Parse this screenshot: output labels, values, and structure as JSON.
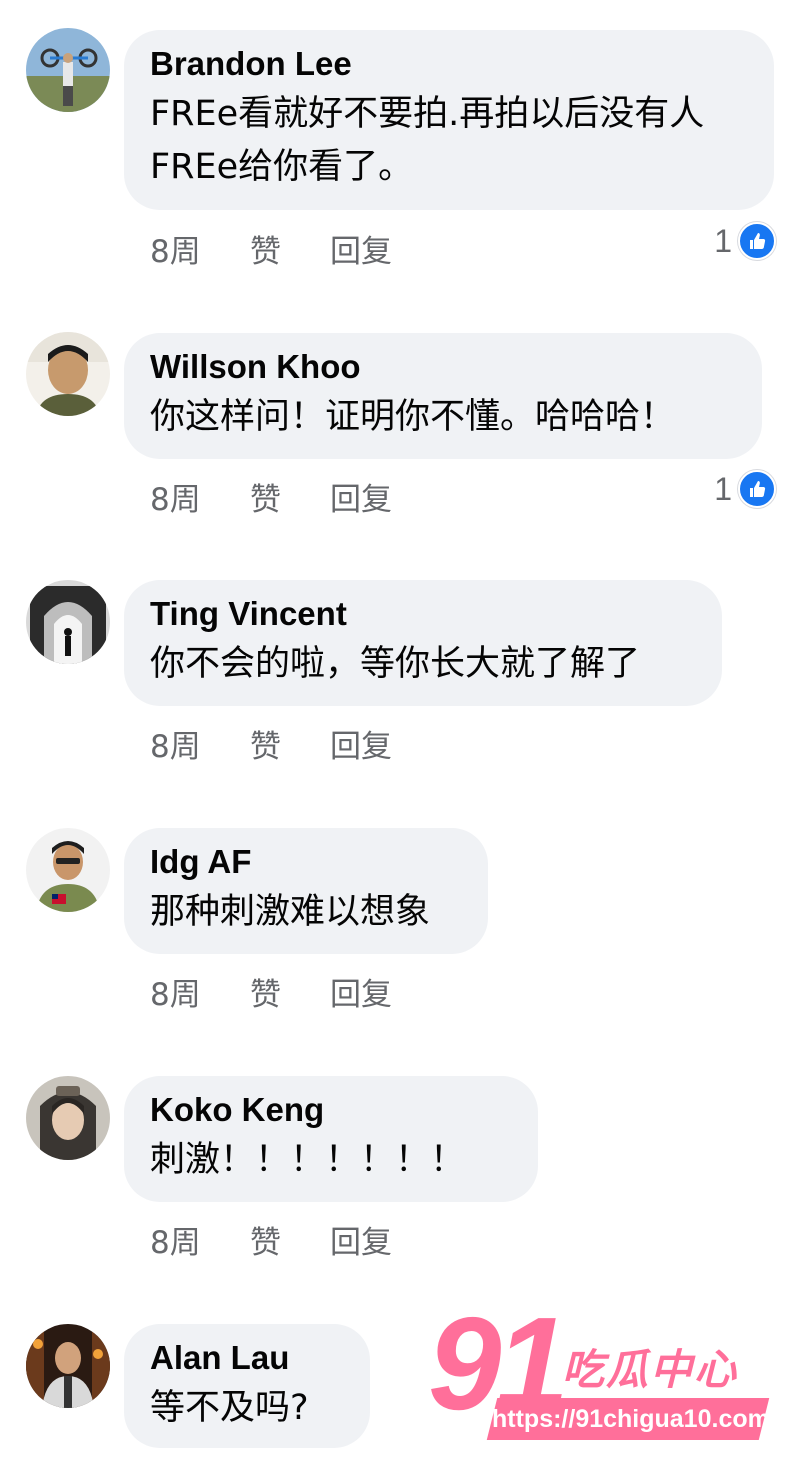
{
  "comments": [
    {
      "author": "Brandon Lee",
      "text": "FREe看就好不要拍.再拍以后没有人FREe给你看了。",
      "time": "8周",
      "like_label": "赞",
      "reply_label": "回复",
      "reactions": "1",
      "avatar": "cyclist-photo"
    },
    {
      "author": "Willson Khoo",
      "text": "你这样问！证明你不懂。哈哈哈！",
      "time": "8周",
      "like_label": "赞",
      "reply_label": "回复",
      "reactions": "1",
      "avatar": "portrait-photo"
    },
    {
      "author": "Ting Vincent",
      "text": "你不会的啦，等你长大就了解了",
      "time": "8周",
      "like_label": "赞",
      "reply_label": "回复",
      "avatar": "bw-arch-photo"
    },
    {
      "author": "Idg AF",
      "text": "那种刺激难以想象",
      "time": "8周",
      "like_label": "赞",
      "reply_label": "回复",
      "avatar": "portrait-photo"
    },
    {
      "author": "Koko Keng",
      "text": "刺激！！！！！！！",
      "time": "8周",
      "like_label": "赞",
      "reply_label": "回复",
      "avatar": "portrait-photo"
    },
    {
      "author": "Alan Lau",
      "text": "等不及吗?",
      "avatar": "stage-photo"
    }
  ],
  "watermark": {
    "number": "91",
    "title": "吃瓜中心",
    "url": "https://91chigua10.com"
  },
  "colors": {
    "bubble": "#f0f2f5",
    "meta_text": "#65676b",
    "like_blue": "#1877f2",
    "watermark_pink": "#ff6f9a"
  }
}
